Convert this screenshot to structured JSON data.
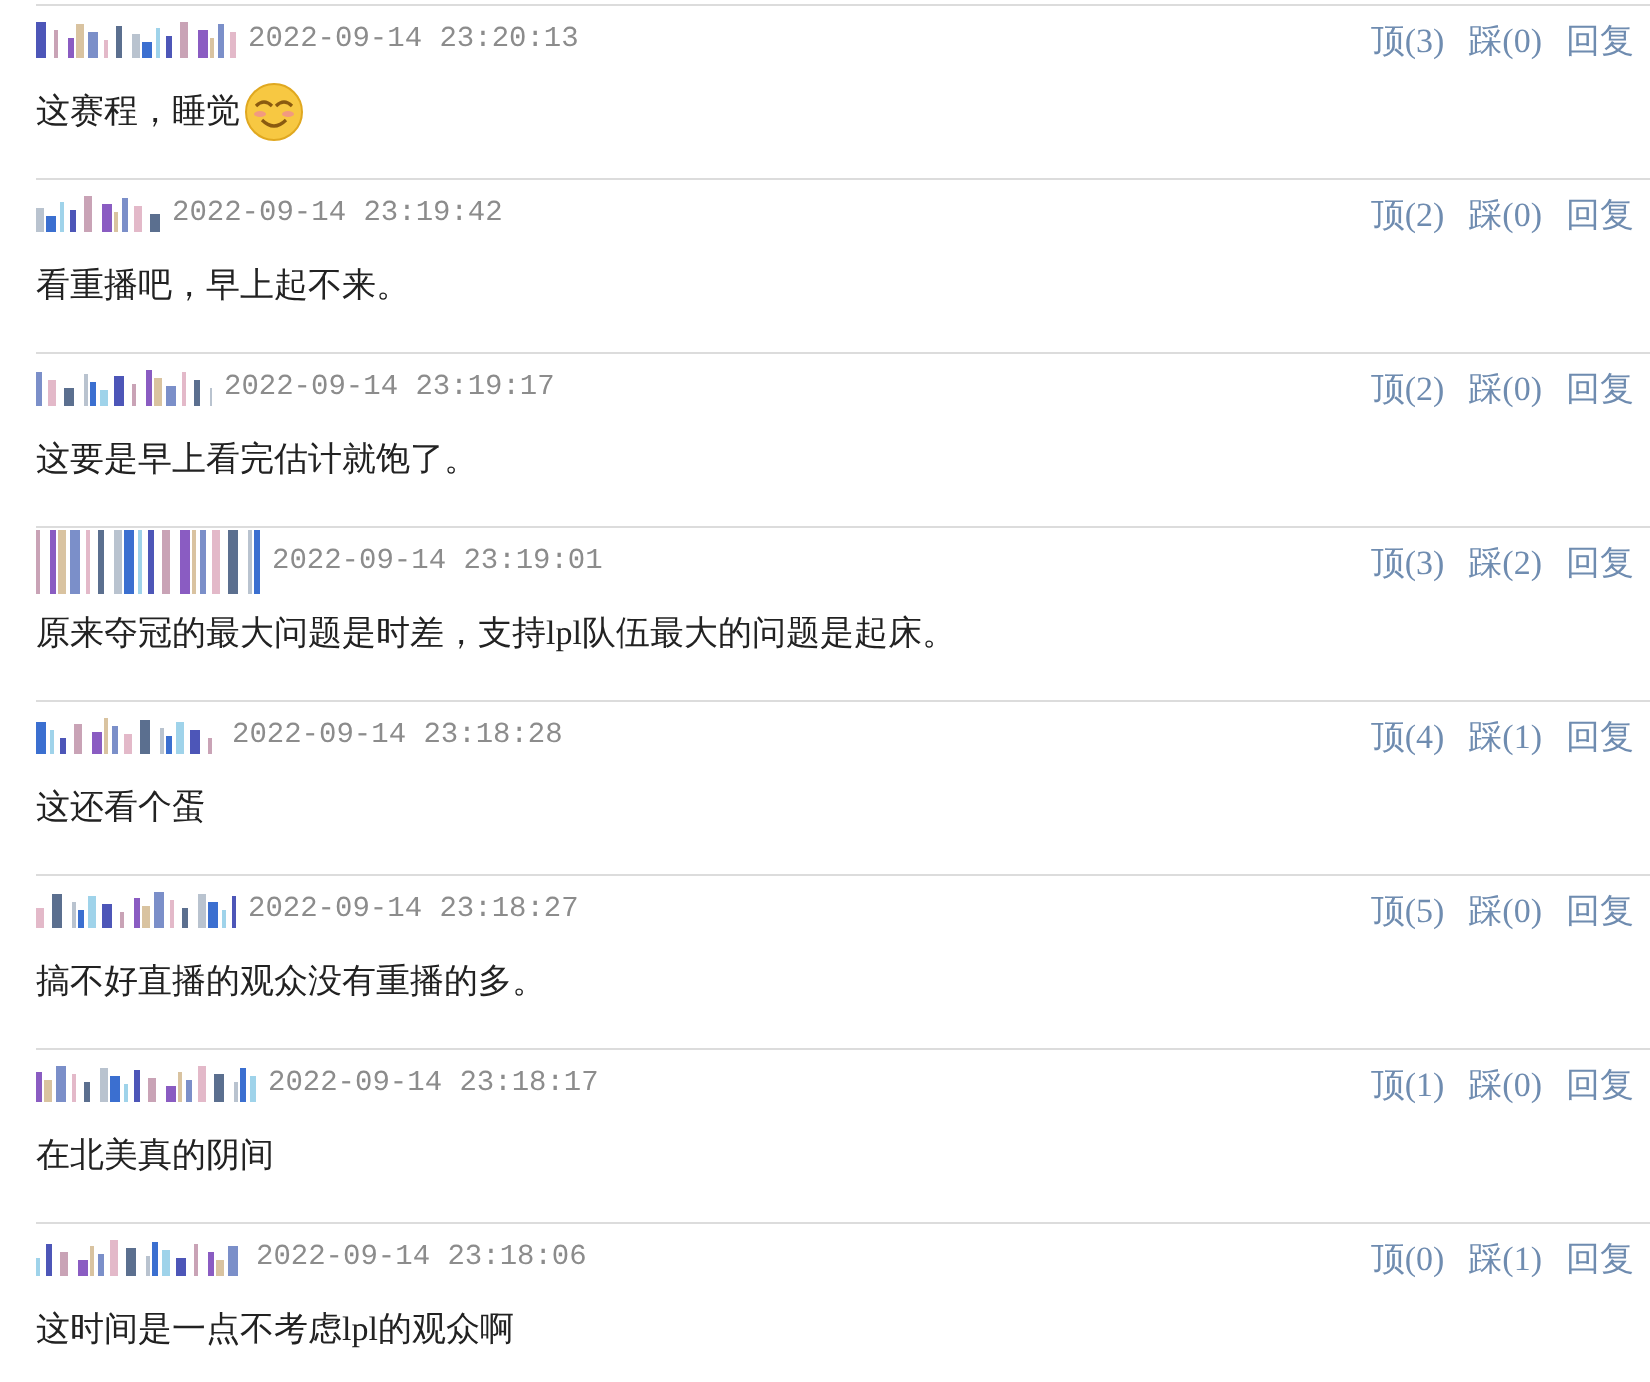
{
  "comments": [
    {
      "time": "2022-09-14 23:20:13",
      "up": "顶(3)",
      "down": "踩(0)",
      "reply": "回复",
      "text": "这赛程，睡觉",
      "emoji": true
    },
    {
      "time": "2022-09-14 23:19:42",
      "up": "顶(2)",
      "down": "踩(0)",
      "reply": "回复",
      "text": "看重播吧，早上起不来。",
      "emoji": false
    },
    {
      "time": "2022-09-14 23:19:17",
      "up": "顶(2)",
      "down": "踩(0)",
      "reply": "回复",
      "text": "这要是早上看完估计就饱了。",
      "emoji": false
    },
    {
      "time": "2022-09-14 23:19:01",
      "up": "顶(3)",
      "down": "踩(2)",
      "reply": "回复",
      "text": "原来夺冠的最大问题是时差，支持lpl队伍最大的问题是起床。",
      "emoji": false
    },
    {
      "time": "2022-09-14 23:18:28",
      "up": "顶(4)",
      "down": "踩(1)",
      "reply": "回复",
      "text": "这还看个蛋",
      "emoji": false
    },
    {
      "time": "2022-09-14 23:18:27",
      "up": "顶(5)",
      "down": "踩(0)",
      "reply": "回复",
      "text": "搞不好直播的观众没有重播的多。",
      "emoji": false
    },
    {
      "time": "2022-09-14 23:18:17",
      "up": "顶(1)",
      "down": "踩(0)",
      "reply": "回复",
      "text": "在北美真的阴间",
      "emoji": false
    },
    {
      "time": "2022-09-14 23:18:06",
      "up": "顶(0)",
      "down": "踩(1)",
      "reply": "回复",
      "text": "这时间是一点不考虑lpl的观众啊",
      "emoji": false
    }
  ]
}
